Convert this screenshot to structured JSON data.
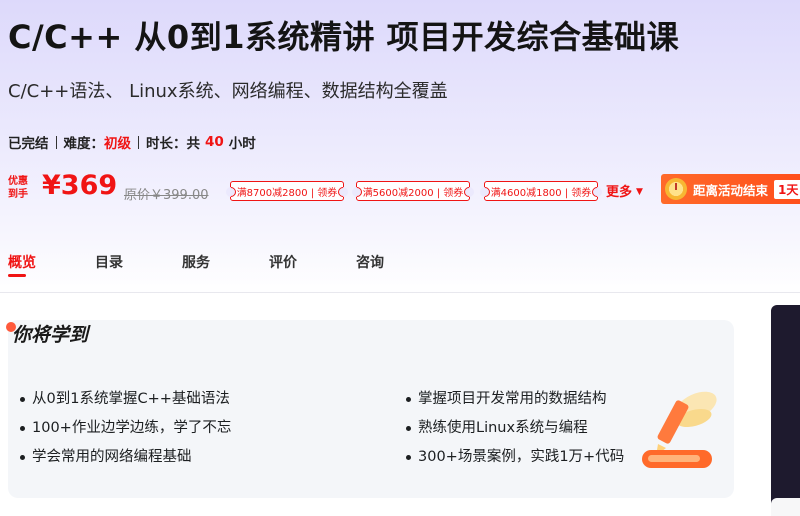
{
  "course": {
    "title": "C/C++ 从0到1系统精讲 项目开发综合基础课",
    "subtitle": "C/C++语法、 Linux系统、网络编程、数据结构全覆盖"
  },
  "meta": {
    "status": "已完结",
    "difficulty_label": "难度：",
    "difficulty_value": "初级",
    "duration_label": "时长：共",
    "duration_value": "40",
    "duration_unit": "小时"
  },
  "pricing": {
    "promo_tag": "优惠到手",
    "price": "¥369",
    "original_price": "原价￥399.00",
    "coupons": [
      "满8700减2800 | 领券",
      "满5600减2000 | 领券",
      "满4600减1800 | 领券"
    ],
    "more_label": "更多",
    "countdown_label": "距离活动结束",
    "countdown_days": "1天"
  },
  "tabs": [
    {
      "label": "概览",
      "active": true
    },
    {
      "label": "目录",
      "active": false
    },
    {
      "label": "服务",
      "active": false
    },
    {
      "label": "评价",
      "active": false
    },
    {
      "label": "咨询",
      "active": false
    }
  ],
  "learn": {
    "heading": "你将学到",
    "left_items": [
      "从0到1系统掌握C++基础语法",
      "100+作业边学边练，学了不忘",
      "学会常用的网络编程基础"
    ],
    "right_items": [
      "掌握项目开发常用的数据结构",
      "熟练使用Linux系统与编程",
      "300+场景案例，实践1万+代码"
    ]
  },
  "colors": {
    "accent": "#f01414",
    "countdown_bg": "#ff5a1f",
    "hero_gradient_top": "#ddd9fb"
  },
  "icons": {
    "more_caret": "caret-down-icon",
    "countdown": "alarm-clock-icon",
    "illustration": "winged-pencil-icon"
  }
}
